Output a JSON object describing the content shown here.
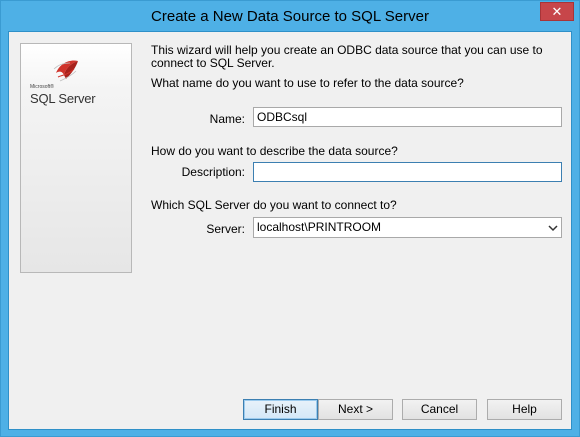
{
  "window": {
    "title": "Create a New Data Source to SQL Server",
    "close_glyph": "✕",
    "accent_color": "#4eb0e6",
    "close_color": "#c7464a"
  },
  "side_panel": {
    "logo_small": "Microsoft®",
    "logo_text": "SQL Server",
    "logo_icon": "sql-server-logo-icon"
  },
  "intro": {
    "text": "This wizard will help you create an ODBC data source that you can use to connect to SQL Server."
  },
  "name_section": {
    "question": "What name do you want to use to refer to the data source?",
    "label": "Name:",
    "value": "ODBCsql"
  },
  "description_section": {
    "question": "How do you want to describe the data source?",
    "label": "Description:",
    "value": ""
  },
  "server_section": {
    "question": "Which SQL Server do you want to connect to?",
    "label": "Server:",
    "value": "localhost\\PRINTROOM",
    "arrow_icon": "chevron-down-icon"
  },
  "buttons": {
    "finish": "Finish",
    "next": "Next >",
    "cancel": "Cancel",
    "help": "Help"
  }
}
